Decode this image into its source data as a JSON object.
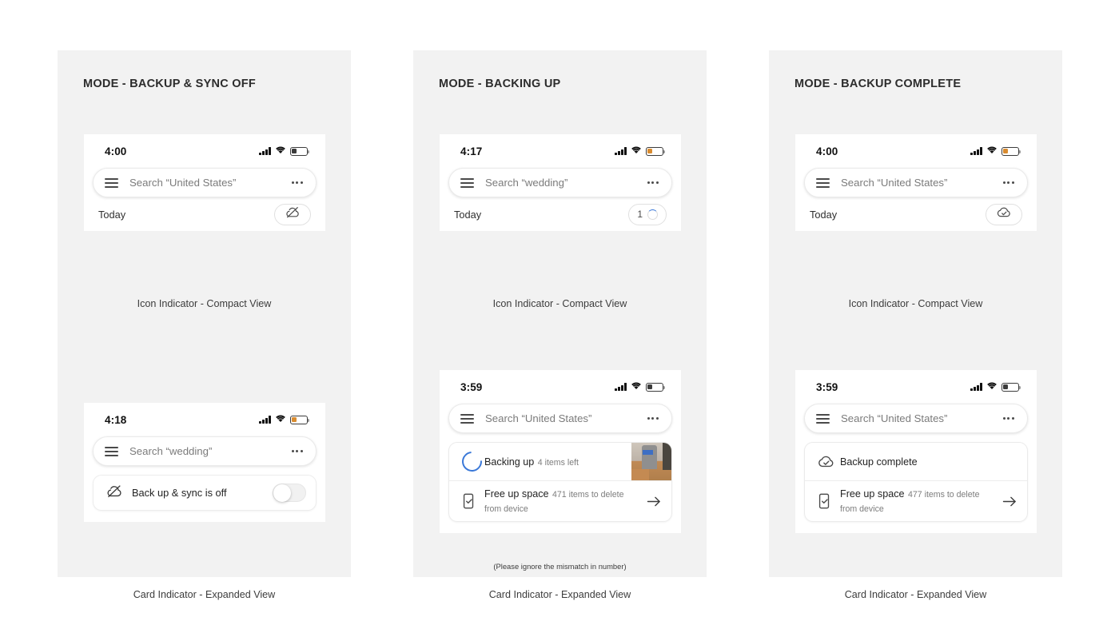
{
  "panels": [
    {
      "title": "MODE - BACKUP & SYNC OFF",
      "compact": {
        "clock": "4:00",
        "search_placeholder": "Search “United States”",
        "today_label": "Today",
        "indicator_icon": "cloud-off-icon",
        "indicator_count": "",
        "caption": "Icon Indicator - Compact View"
      },
      "expanded": {
        "clock": "4:18",
        "search_placeholder": "Search “wedding”",
        "caption": "Card Indicator - Expanded View",
        "subcaption": "",
        "toggle_icon": "cloud-off-icon",
        "toggle_label": "Back up & sync is off",
        "toggle_state": "off",
        "rows": []
      }
    },
    {
      "title": "MODE - BACKING UP",
      "compact": {
        "clock": "4:17",
        "search_placeholder": "Search “wedding”",
        "today_label": "Today",
        "indicator_icon": "progress-spinner-icon",
        "indicator_count": "1",
        "caption": "Icon Indicator - Compact View"
      },
      "expanded": {
        "clock": "3:59",
        "search_placeholder": "Search “United States”",
        "caption": "Card Indicator - Expanded View",
        "subcaption": "(Please ignore the mismatch in number)",
        "rows": [
          {
            "icon": "progress-spinner-icon",
            "title": "Backing up",
            "subtitle": "4 items left",
            "trailing": "photo-thumbnail"
          },
          {
            "icon": "free-up-space-icon",
            "title": "Free up space",
            "subtitle": "471 items to delete from device",
            "trailing": "arrow-right-icon"
          }
        ]
      }
    },
    {
      "title": "MODE - BACKUP COMPLETE",
      "compact": {
        "clock": "4:00",
        "search_placeholder": "Search “United States”",
        "today_label": "Today",
        "indicator_icon": "cloud-done-icon",
        "indicator_count": "",
        "caption": "Icon Indicator - Compact View"
      },
      "expanded": {
        "clock": "3:59",
        "search_placeholder": "Search “United States”",
        "caption": "Card Indicator - Expanded View",
        "subcaption": "",
        "rows": [
          {
            "icon": "cloud-done-icon",
            "title": "Backup complete",
            "subtitle": "",
            "trailing": "none"
          },
          {
            "icon": "free-up-space-icon",
            "title": "Free up space",
            "subtitle": "477 items to delete from device",
            "trailing": "arrow-right-icon"
          }
        ]
      }
    }
  ],
  "colors": {
    "panel_background": "#f2f2f2",
    "page_background": "#ffffff",
    "accent_blue": "#3a78d8",
    "text_primary": "#232323",
    "text_secondary": "#7d7d7d",
    "battery_low": "#d98c30"
  },
  "status_icons": {
    "signal": "cellular-signal-icon",
    "wifi": "wifi-icon",
    "battery": "battery-icon"
  },
  "search_icons": {
    "menu": "hamburger-menu-icon",
    "overflow": "more-options-icon"
  }
}
